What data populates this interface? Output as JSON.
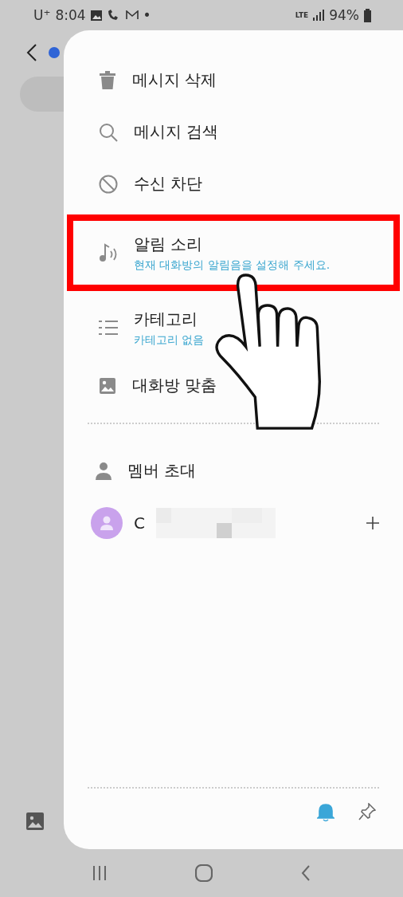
{
  "status_bar": {
    "carrier": "U⁺",
    "time": "8:04",
    "dot": "•",
    "network": "LTE",
    "battery": "94%"
  },
  "menu": [
    {
      "label": "메시지 삭제",
      "highlighted": false
    },
    {
      "label": "메시지 검색",
      "highlighted": false
    },
    {
      "label": "수신 차단",
      "highlighted": false
    },
    {
      "label": "알림 소리",
      "subtitle": "현재 대화방의 알림음을 설정해 주세요.",
      "highlighted": true
    },
    {
      "label": "카테고리",
      "subtitle": "카테고리 없음",
      "highlighted": false
    },
    {
      "label": "대화방 맞춤",
      "highlighted": false
    }
  ],
  "invite": {
    "label": "멤버 초대"
  },
  "members": [
    {
      "name": "C"
    }
  ],
  "footer": {
    "notifications_on": true
  }
}
